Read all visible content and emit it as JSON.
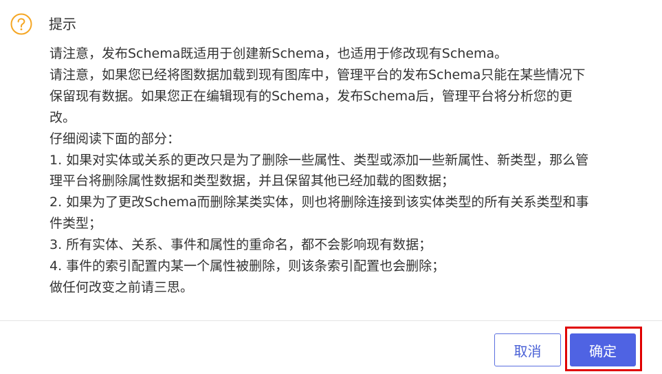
{
  "dialog": {
    "title": "提示",
    "icon": "question-warning-icon",
    "icon_color": "#f5a623",
    "lines": [
      "请注意，发布Schema既适用于创建新Schema，也适用于修改现有Schema。",
      "请注意，如果您已经将图数据加载到现有图库中，管理平台的发布Schema只能在某些情况下",
      "保留现有数据。如果您正在编辑现有的Schema，发布Schema后，管理平台将分析您的更",
      "改。",
      "仔细阅读下面的部分：",
      "1. 如果对实体或关系的更改只是为了删除一些属性、类型或添加一些新属性、新类型，那么管",
      "理平台将删除属性数据和类型数据，并且保留其他已经加载的图数据；",
      "2. 如果为了更改Schema而删除某类实体，则也将删除连接到该实体类型的所有关系类型和事",
      "件类型；",
      "3. 所有实体、关系、事件和属性的重命名，都不会影响现有数据；",
      "4. 事件的索引配置内某一个属性被删除，则该条索引配置也会删除；",
      "做任何改变之前请三思。"
    ],
    "buttons": {
      "cancel_label": "取消",
      "confirm_label": "确定"
    },
    "colors": {
      "primary": "#4f63e3",
      "highlight": "#e00000",
      "warning": "#f5a623"
    }
  }
}
